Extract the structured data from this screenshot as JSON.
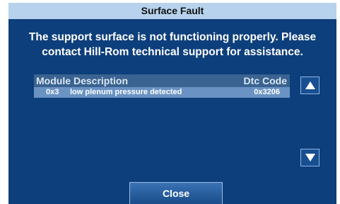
{
  "dialog": {
    "title": "Surface Fault",
    "message_line1": "The support surface is not functioning properly. Please",
    "message_line2": "contact Hill-Rom technical support for assistance."
  },
  "table": {
    "headers": {
      "module": "Module",
      "description": "Description",
      "dtc_code": "Dtc Code"
    },
    "rows": [
      {
        "module": "0x3",
        "description": "low plenum pressure detected",
        "dtc_code": "0x3206"
      }
    ]
  },
  "scroll": {
    "up_icon": "triangle-up-icon",
    "down_icon": "triangle-down-icon"
  },
  "buttons": {
    "close_label": "Close"
  },
  "colors": {
    "dialog_bg": "#0d3f7c",
    "titlebar_bg": "#b7d2ec",
    "header_row_bg": "#3a6391",
    "data_row_bg": "#6a93c3"
  }
}
